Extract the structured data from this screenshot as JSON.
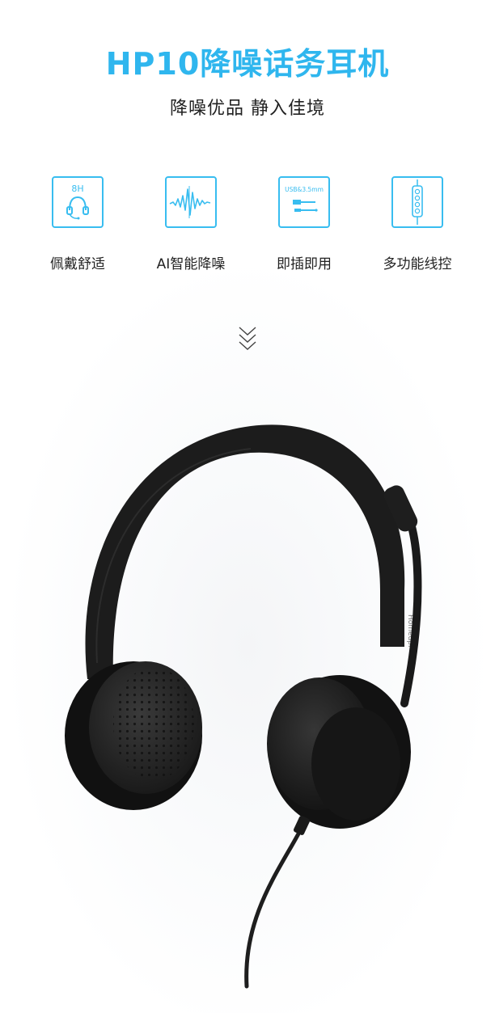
{
  "header": {
    "title": "HP10降噪话务耳机",
    "subtitle": "降噪优品 静入佳境"
  },
  "features": [
    {
      "label": "佩戴舒适",
      "icon": "headset-8h-icon",
      "icon_text": "8H"
    },
    {
      "label": "AI智能降噪",
      "icon": "soundwave-icon"
    },
    {
      "label": "即插即用",
      "icon": "usb-jack-icon",
      "icon_text": "USB&3.5mm"
    },
    {
      "label": "多功能线控",
      "icon": "inline-remote-icon"
    }
  ],
  "colors": {
    "accent": "#2fb6ee",
    "text": "#222222",
    "product": "#1c1c1c"
  },
  "scroll_hint_icon": "double-chevron-down-icon",
  "product": {
    "logo_text": "Homedpi",
    "image": "black-headset-with-boom-mic"
  }
}
